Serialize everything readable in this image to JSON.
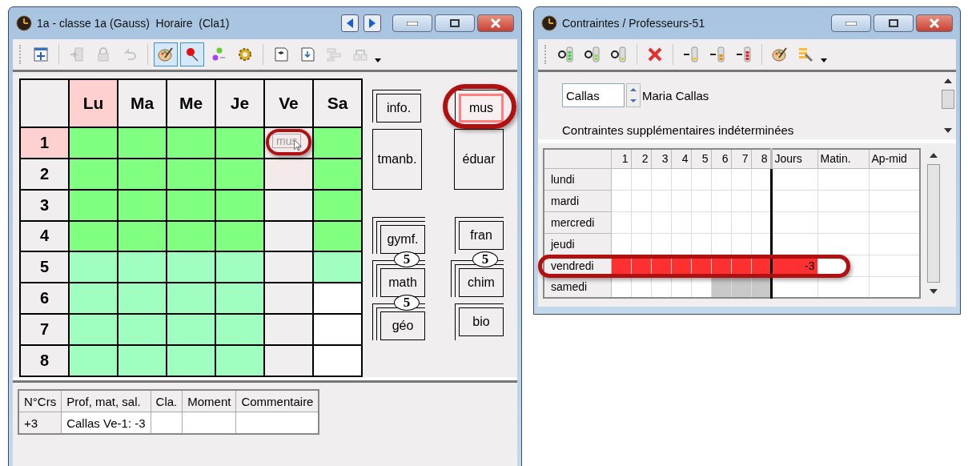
{
  "timetable_window": {
    "title": "1a - classe 1a (Gauss)  Horaire  (Cla1)",
    "toolbar": [
      {
        "kind": "button",
        "pressed": false,
        "disabled": false
      },
      {
        "kind": "separator"
      },
      {
        "kind": "button",
        "pressed": false,
        "disabled": true
      },
      {
        "kind": "button",
        "pressed": false,
        "disabled": true
      },
      {
        "kind": "button",
        "pressed": false,
        "disabled": true
      },
      {
        "kind": "separator"
      },
      {
        "kind": "button",
        "pressed": true,
        "disabled": false
      },
      {
        "kind": "button",
        "pressed": true,
        "disabled": false
      },
      {
        "kind": "button",
        "pressed": false,
        "disabled": false
      },
      {
        "kind": "button",
        "pressed": false,
        "disabled": false
      },
      {
        "kind": "separator"
      },
      {
        "kind": "button",
        "pressed": false,
        "disabled": false
      },
      {
        "kind": "button",
        "pressed": false,
        "disabled": false
      },
      {
        "kind": "button",
        "pressed": false,
        "disabled": true
      },
      {
        "kind": "button",
        "pressed": false,
        "disabled": true
      },
      {
        "kind": "dropdown"
      }
    ],
    "days": [
      {
        "label": "Lu",
        "selected": true
      },
      {
        "label": "Ma",
        "selected": false
      },
      {
        "label": "Me",
        "selected": false
      },
      {
        "label": "Je",
        "selected": false
      },
      {
        "label": "Ve",
        "selected": false
      },
      {
        "label": "Sa",
        "selected": false
      }
    ],
    "rows": [
      {
        "label": "1",
        "selected": true,
        "cells": [
          {
            "color": "#80ff80"
          },
          {
            "color": "#80ff80"
          },
          {
            "color": "#80ff80"
          },
          {
            "color": "#80ff80"
          },
          {
            "color": "#f4eaea",
            "ghost": {
              "label": "mus",
              "highlighted": true
            }
          },
          {
            "color": "#80ff80"
          }
        ]
      },
      {
        "label": "2",
        "selected": false,
        "cells": [
          {
            "color": "#80ff80"
          },
          {
            "color": "#80ff80"
          },
          {
            "color": "#80ff80"
          },
          {
            "color": "#80ff80"
          },
          {
            "color": "#f4eaea"
          },
          {
            "color": "#80ff80"
          }
        ]
      },
      {
        "label": "3",
        "selected": false,
        "cells": [
          {
            "color": "#80ff80"
          },
          {
            "color": "#80ff80"
          },
          {
            "color": "#80ff80"
          },
          {
            "color": "#80ff80"
          },
          {
            "color": "#f0eeee"
          },
          {
            "color": "#80ff80"
          }
        ]
      },
      {
        "label": "4",
        "selected": false,
        "cells": [
          {
            "color": "#80ff80"
          },
          {
            "color": "#80ff80"
          },
          {
            "color": "#80ff80"
          },
          {
            "color": "#80ff80"
          },
          {
            "color": "#f0eeee"
          },
          {
            "color": "#80ff80"
          }
        ]
      },
      {
        "label": "5",
        "selected": false,
        "cells": [
          {
            "color": "#a0ffc0"
          },
          {
            "color": "#a0ffc0"
          },
          {
            "color": "#a0ffc0"
          },
          {
            "color": "#a0ffc0"
          },
          {
            "color": "#f0eeee"
          },
          {
            "color": "#a0ffc0"
          }
        ]
      },
      {
        "label": "6",
        "selected": false,
        "cells": [
          {
            "color": "#a0ffc0"
          },
          {
            "color": "#a0ffc0"
          },
          {
            "color": "#a0ffc0"
          },
          {
            "color": "#a0ffc0"
          },
          {
            "color": "#f0eeee"
          },
          {
            "color": "#ffffff"
          }
        ]
      },
      {
        "label": "7",
        "selected": false,
        "cells": [
          {
            "color": "#a0ffc0"
          },
          {
            "color": "#a0ffc0"
          },
          {
            "color": "#a0ffc0"
          },
          {
            "color": "#a0ffc0"
          },
          {
            "color": "#f0eeee"
          },
          {
            "color": "#ffffff"
          }
        ]
      },
      {
        "label": "8",
        "selected": false,
        "cells": [
          {
            "color": "#a0ffc0"
          },
          {
            "color": "#a0ffc0"
          },
          {
            "color": "#a0ffc0"
          },
          {
            "color": "#a0ffc0"
          },
          {
            "color": "#f0eeee"
          },
          {
            "color": "#ffffff"
          }
        ]
      }
    ],
    "card_rows": [
      [
        {
          "label": "info.",
          "kind": "double",
          "selected": false,
          "highlighted": false
        },
        {
          "label": "mus",
          "kind": "double",
          "selected": true,
          "highlighted": true
        }
      ],
      [
        {
          "label": "tmanb.",
          "kind": "tall",
          "selected": false,
          "highlighted": false
        },
        {
          "label": "éduar",
          "kind": "tall",
          "selected": false,
          "highlighted": false
        }
      ],
      [
        {
          "label": "gymf.",
          "kind": "triple",
          "selected": false,
          "highlighted": false
        },
        {
          "label": "fran",
          "kind": "double",
          "selected": false,
          "highlighted": false
        }
      ],
      [
        {
          "label": "math",
          "kind": "triple",
          "selected": false,
          "highlighted": false,
          "badge": "5"
        },
        {
          "label": "chim",
          "kind": "triple",
          "selected": false,
          "highlighted": false,
          "badge": "5"
        }
      ],
      [
        {
          "label": "géo",
          "kind": "triple",
          "selected": false,
          "highlighted": false,
          "badge": "5"
        },
        {
          "label": "bio",
          "kind": "double",
          "selected": false,
          "highlighted": false
        }
      ]
    ],
    "lessons": {
      "columns": [
        "N°Crs",
        "Prof, mat, sal.",
        "Cla.",
        "Moment",
        "Commentaire"
      ],
      "rows": [
        [
          "+3",
          "Callas Ve-1: -3",
          "",
          "",
          ""
        ]
      ]
    }
  },
  "constraints_window": {
    "title": "Contraintes / Professeurs-51",
    "toolbar": [
      {
        "kind": "button",
        "pressed": false,
        "disabled": false
      },
      {
        "kind": "button",
        "pressed": false,
        "disabled": false
      },
      {
        "kind": "button",
        "pressed": false,
        "disabled": false
      },
      {
        "kind": "separator"
      },
      {
        "kind": "button",
        "pressed": false,
        "disabled": false
      },
      {
        "kind": "separator"
      },
      {
        "kind": "button",
        "pressed": false,
        "disabled": false
      },
      {
        "kind": "button",
        "pressed": false,
        "disabled": false
      },
      {
        "kind": "button",
        "pressed": false,
        "disabled": false
      },
      {
        "kind": "separator"
      },
      {
        "kind": "button",
        "pressed": false,
        "disabled": false
      },
      {
        "kind": "button",
        "pressed": false,
        "disabled": false
      },
      {
        "kind": "dropdown"
      }
    ],
    "teacher_field": {
      "value": "Callas"
    },
    "teacher_name": "Maria Callas",
    "note": "Contraintes supplémentaires indéterminées",
    "columns": [
      "1",
      "2",
      "3",
      "4",
      "5",
      "6",
      "7",
      "8",
      "Jours",
      "Matin.",
      "Ap-mid"
    ],
    "rows": [
      {
        "day": "lundi",
        "highlighted": false,
        "cells": [
          {
            "color": "#ffffff"
          },
          {
            "color": "#ffffff"
          },
          {
            "color": "#ffffff"
          },
          {
            "color": "#ffffff"
          },
          {
            "color": "#ffffff"
          },
          {
            "color": "#ffffff"
          },
          {
            "color": "#ffffff"
          },
          {
            "color": "#ffffff"
          },
          {
            "color": "#ffffff"
          },
          {
            "color": "#ffffff"
          },
          {
            "color": "#ffffff"
          }
        ]
      },
      {
        "day": "mardi",
        "highlighted": false,
        "cells": [
          {
            "color": "#ffffff"
          },
          {
            "color": "#ffffff"
          },
          {
            "color": "#ffffff"
          },
          {
            "color": "#ffffff"
          },
          {
            "color": "#ffffff"
          },
          {
            "color": "#ffffff"
          },
          {
            "color": "#ffffff"
          },
          {
            "color": "#ffffff"
          },
          {
            "color": "#ffffff"
          },
          {
            "color": "#ffffff"
          },
          {
            "color": "#ffffff"
          }
        ]
      },
      {
        "day": "mercredi",
        "highlighted": false,
        "cells": [
          {
            "color": "#ffffff"
          },
          {
            "color": "#ffffff"
          },
          {
            "color": "#ffffff"
          },
          {
            "color": "#ffffff"
          },
          {
            "color": "#ffffff"
          },
          {
            "color": "#ffffff"
          },
          {
            "color": "#ffffff"
          },
          {
            "color": "#ffffff"
          },
          {
            "color": "#ffffff"
          },
          {
            "color": "#ffffff"
          },
          {
            "color": "#ffffff"
          }
        ]
      },
      {
        "day": "jeudi",
        "highlighted": false,
        "cells": [
          {
            "color": "#ffffff"
          },
          {
            "color": "#ffffff"
          },
          {
            "color": "#ffffff"
          },
          {
            "color": "#ffffff"
          },
          {
            "color": "#ffffff"
          },
          {
            "color": "#ffffff"
          },
          {
            "color": "#ffffff"
          },
          {
            "color": "#ffffff"
          },
          {
            "color": "#ffffff"
          },
          {
            "color": "#ffffff"
          },
          {
            "color": "#ffffff"
          }
        ]
      },
      {
        "day": "vendredi",
        "highlighted": true,
        "cells": [
          {
            "color": "#ff3030"
          },
          {
            "color": "#ff3030"
          },
          {
            "color": "#ff3030"
          },
          {
            "color": "#ff3030"
          },
          {
            "color": "#ff3030"
          },
          {
            "color": "#ff3030"
          },
          {
            "color": "#ff3030"
          },
          {
            "color": "#ff3030"
          },
          {
            "color": "#ff3030",
            "text": "-3"
          },
          {
            "color": "#ffffff"
          },
          {
            "color": "#ffffff"
          }
        ]
      },
      {
        "day": "samedi",
        "highlighted": false,
        "cells": [
          {
            "color": "#ffffff"
          },
          {
            "color": "#ffffff"
          },
          {
            "color": "#ffffff"
          },
          {
            "color": "#ffffff"
          },
          {
            "color": "#ffffff"
          },
          {
            "color": "#c8c8c8"
          },
          {
            "color": "#c8c8c8"
          },
          {
            "color": "#c8c8c8"
          },
          {
            "color": "#ffffff"
          },
          {
            "color": "#ffffff"
          },
          {
            "color": "#ffffff"
          }
        ]
      }
    ]
  }
}
